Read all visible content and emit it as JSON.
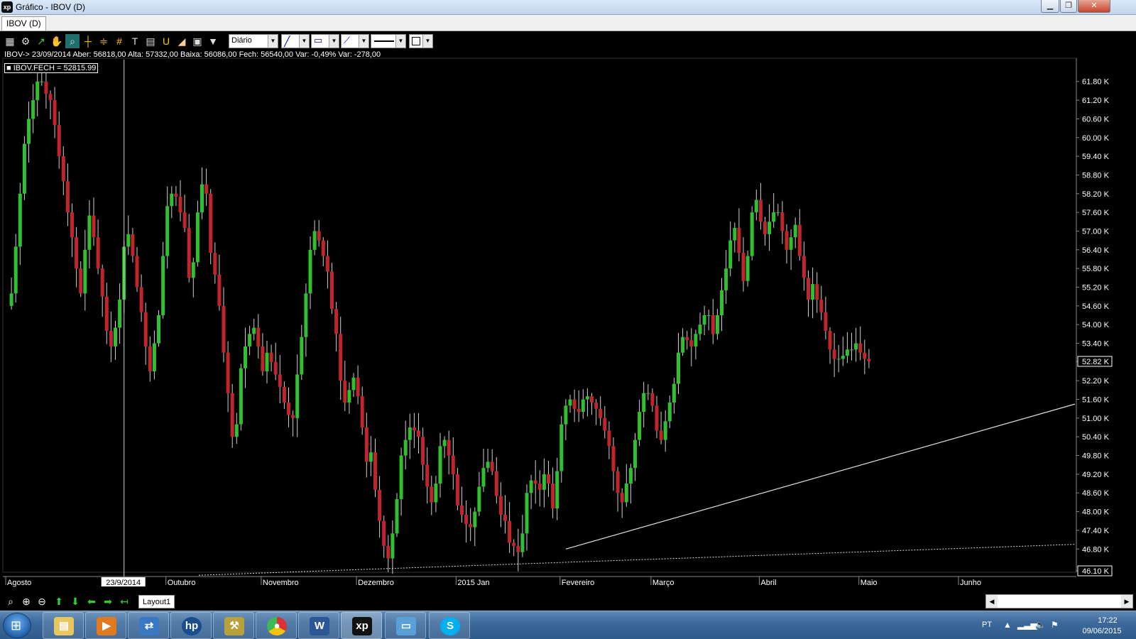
{
  "window": {
    "title": "Gráfico - IBOV (D)",
    "logo": "xp",
    "controls": [
      "minimize-icon",
      "restore-icon",
      "close-icon"
    ]
  },
  "tabs": [
    {
      "label": "IBOV (D)",
      "active": true
    }
  ],
  "toolbar": {
    "icons": [
      "chart-icon",
      "gear-icon",
      "trend-icon",
      "hand-icon",
      "zoom-area-icon",
      "crosshair-icon",
      "fibonacci-icon",
      "grid-icon",
      "text-icon",
      "calculator-icon",
      "magnet-icon",
      "eraser-icon",
      "clipboard-icon",
      "filter-icon"
    ],
    "period": "Diário",
    "period_options": [
      "Diário"
    ]
  },
  "info_line": "IBOV-> 23/09/2014 Aber: 56818,00 Alta: 57332,00 Baixa: 56086,00 Fech: 56540,00 Var: -0,49% Var: -278,00",
  "series_label": "■ IBOV.FECH = 52815.99",
  "chart_data": {
    "type": "candlestick",
    "symbol": "IBOV",
    "y_unit": "K",
    "ylim": [
      46.1,
      62.5
    ],
    "y_ticks": [
      61.8,
      61.2,
      60.6,
      60.0,
      59.4,
      58.8,
      58.2,
      57.6,
      57.0,
      56.4,
      55.8,
      55.2,
      54.6,
      54.0,
      53.4,
      52.82,
      52.2,
      51.6,
      51.0,
      50.4,
      49.8,
      49.2,
      48.6,
      48.0,
      47.4,
      46.8,
      46.1
    ],
    "y_tick_labels": [
      "61.80 K",
      "61.20 K",
      "60.60 K",
      "60.00 K",
      "59.40 K",
      "58.80 K",
      "58.20 K",
      "57.60 K",
      "57.00 K",
      "56.40 K",
      "55.80 K",
      "55.20 K",
      "54.60 K",
      "54.00 K",
      "53.40 K",
      "52.82 K",
      "52.20 K",
      "51.60 K",
      "51.00 K",
      "50.40 K",
      "49.80 K",
      "49.20 K",
      "48.60 K",
      "48.00 K",
      "47.40 K",
      "46.80 K",
      "46.10 K"
    ],
    "highlight_labels": {
      "last": "52.82 K",
      "min": "46.10 K"
    },
    "x_labels": [
      {
        "label": "Agosto",
        "index": 0
      },
      {
        "label": "Outubro",
        "index": 37
      },
      {
        "label": "Novembro",
        "index": 59
      },
      {
        "label": "Dezembro",
        "index": 81
      },
      {
        "label": "2015 Jan",
        "index": 104
      },
      {
        "label": "Fevereiro",
        "index": 128
      },
      {
        "label": "Março",
        "index": 149
      },
      {
        "label": "Abril",
        "index": 174
      },
      {
        "label": "Maio",
        "index": 197
      },
      {
        "label": "Junho",
        "index": 220
      }
    ],
    "cursor": {
      "index": 27,
      "date_label": "23/9/2014"
    },
    "closes": [
      54.6,
      55.0,
      56.5,
      58.2,
      59.8,
      60.6,
      61.2,
      61.8,
      61.8,
      61.4,
      61.2,
      60.4,
      59.4,
      58.6,
      57.6,
      56.8,
      55.8,
      55.0,
      56.4,
      57.5,
      56.8,
      55.8,
      54.9,
      53.8,
      53.3,
      53.9,
      54.8,
      56.5,
      56.9,
      56.2,
      55.2,
      54.4,
      53.3,
      52.5,
      53.4,
      54.3,
      56.2,
      57.8,
      58.2,
      58.1,
      57.6,
      57.1,
      55.5,
      56.0,
      57.6,
      58.5,
      58.2,
      56.3,
      55.6,
      54.6,
      53.1,
      51.8,
      50.4,
      50.8,
      52.6,
      53.3,
      53.7,
      53.9,
      53.3,
      52.5,
      53.1,
      52.8,
      52.4,
      52.0,
      51.5,
      51.1,
      51.0,
      52.4,
      53.6,
      55.0,
      56.4,
      57.0,
      56.7,
      56.2,
      55.7,
      54.5,
      53.7,
      52.2,
      51.5,
      51.9,
      52.3,
      51.7,
      50.7,
      49.6,
      49.9,
      48.7,
      47.7,
      46.9,
      46.5,
      47.3,
      48.4,
      49.8,
      50.3,
      50.7,
      50.6,
      50.4,
      49.5,
      48.8,
      48.3,
      48.9,
      50.1,
      50.3,
      49.8,
      49.2,
      48.2,
      47.9,
      47.6,
      47.5,
      48.0,
      48.8,
      49.4,
      49.6,
      49.3,
      48.5,
      47.9,
      47.7,
      47.0,
      46.9,
      46.7,
      47.3,
      48.6,
      49.0,
      48.9,
      48.7,
      49.2,
      48.9,
      48.1,
      49.3,
      50.8,
      51.4,
      51.6,
      51.3,
      51.2,
      51.6,
      51.7,
      51.5,
      51.3,
      51.0,
      50.6,
      50.1,
      49.3,
      48.6,
      48.3,
      48.9,
      49.4,
      50.3,
      51.2,
      51.8,
      51.8,
      51.4,
      50.6,
      50.3,
      50.9,
      51.5,
      52.1,
      53.1,
      53.6,
      53.5,
      53.3,
      53.7,
      54.0,
      54.3,
      54.3,
      53.7,
      54.3,
      55.1,
      55.8,
      56.7,
      57.1,
      56.3,
      55.4,
      56.2,
      57.6,
      58.0,
      57.3,
      56.9,
      57.3,
      57.6,
      57.6,
      57.0,
      56.4,
      56.8,
      57.2,
      56.2,
      55.5,
      54.8,
      55.3,
      54.8,
      54.4,
      53.8,
      53.2,
      52.9,
      52.9,
      53.0,
      53.2,
      53.2,
      53.4,
      53.1,
      52.9,
      52.82
    ],
    "overlays": [
      "support-trendline",
      "dotted-moving-average"
    ]
  },
  "bottom": {
    "icons": [
      "zoom-icon",
      "zoom-in-icon",
      "zoom-out-icon",
      "arrow-up-icon",
      "arrow-down-icon",
      "arrow-left-icon",
      "arrow-right-icon",
      "arrow-back-icon"
    ],
    "layout_tab": "Layout1"
  },
  "taskbar": {
    "apps": [
      "folder-icon",
      "media-player-icon",
      "network-icon",
      "hp-icon",
      "tool-icon",
      "chrome-icon",
      "word-icon",
      "xp-icon",
      "picture-icon",
      "skype-icon"
    ],
    "lang": "PT",
    "time": "17:22",
    "date": "09/06/2015"
  }
}
